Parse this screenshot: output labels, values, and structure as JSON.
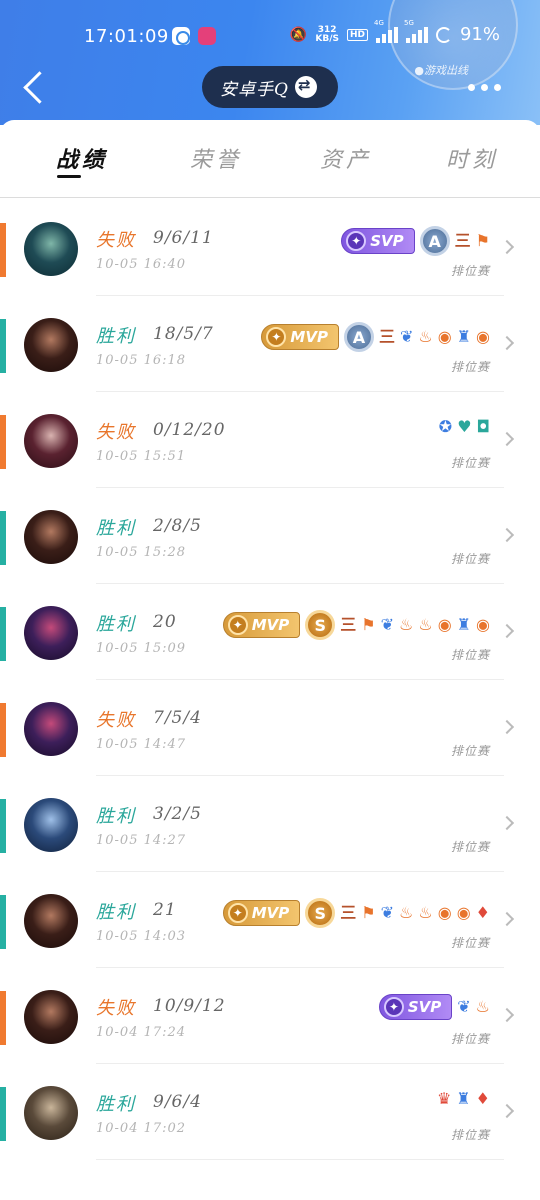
{
  "status_bar": {
    "time": "17:01:09",
    "net_speed_value": "312",
    "net_speed_unit": "KB/S",
    "hd": "HD",
    "sig1": "4G",
    "sig2": "5G",
    "battery": "91%"
  },
  "header": {
    "account_label": "安卓手Q",
    "deco_label": "●游戏出线"
  },
  "tabs": [
    "战绩",
    "荣誉",
    "资产",
    "时刻"
  ],
  "matches": [
    {
      "result": "失败",
      "outcome": "lose",
      "kda": "9/6/11",
      "time": "10-05 16:40",
      "mode": "排位赛",
      "badge": {
        "type": "svp",
        "label": "SVP"
      },
      "grade": "A",
      "icons": [
        "三",
        "⚑"
      ],
      "avatar_colors": [
        "#1f4b55",
        "#7fb6a8",
        "#0c2b33"
      ]
    },
    {
      "result": "胜利",
      "outcome": "win",
      "kda": "18/5/7",
      "time": "10-05 16:18",
      "mode": "排位赛",
      "badge": {
        "type": "mvp",
        "label": "MVP"
      },
      "grade": "A",
      "icons": [
        "三",
        "❦",
        "♨",
        "◉",
        "♜",
        "◉"
      ],
      "avatar_colors": [
        "#3a1e18",
        "#b27960",
        "#1a0b09"
      ]
    },
    {
      "result": "失败",
      "outcome": "lose",
      "kda": "0/12/20",
      "time": "10-05 15:51",
      "mode": "排位赛",
      "badge": null,
      "grade": null,
      "icons": [
        "✪",
        "♥",
        "◘"
      ],
      "avatar_colors": [
        "#5a2230",
        "#d9b3b0",
        "#2a0d14"
      ]
    },
    {
      "result": "胜利",
      "outcome": "win",
      "kda": "2/8/5",
      "time": "10-05 15:28",
      "mode": "排位赛",
      "badge": null,
      "grade": null,
      "icons": [],
      "avatar_colors": [
        "#3a1e18",
        "#b27960",
        "#1a0b09"
      ]
    },
    {
      "result": "胜利",
      "outcome": "win",
      "kda": "20",
      "time": "10-05 15:09",
      "mode": "排位赛",
      "badge": {
        "type": "mvp",
        "label": "MVP"
      },
      "grade": "S",
      "icons": [
        "三",
        "⚑",
        "❦",
        "♨",
        "♨",
        "◉",
        "♜",
        "◉"
      ],
      "avatar_colors": [
        "#3d1f5a",
        "#c44a7a",
        "#150a26"
      ]
    },
    {
      "result": "失败",
      "outcome": "lose",
      "kda": "7/5/4",
      "time": "10-05 14:47",
      "mode": "排位赛",
      "badge": null,
      "grade": null,
      "icons": [],
      "avatar_colors": [
        "#3d1f5a",
        "#c44a7a",
        "#150a26"
      ]
    },
    {
      "result": "胜利",
      "outcome": "win",
      "kda": "3/2/5",
      "time": "10-05 14:27",
      "mode": "排位赛",
      "badge": null,
      "grade": null,
      "icons": [],
      "avatar_colors": [
        "#2b4a7a",
        "#9fc0e8",
        "#0f1f3a"
      ]
    },
    {
      "result": "胜利",
      "outcome": "win",
      "kda": "21",
      "time": "10-05 14:03",
      "mode": "排位赛",
      "badge": {
        "type": "mvp",
        "label": "MVP"
      },
      "grade": "S",
      "icons": [
        "三",
        "⚑",
        "❦",
        "♨",
        "♨",
        "◉",
        "◉",
        "♦"
      ],
      "avatar_colors": [
        "#3a1e18",
        "#b27960",
        "#1a0b09"
      ]
    },
    {
      "result": "失败",
      "outcome": "lose",
      "kda": "10/9/12",
      "time": "10-04 17:24",
      "mode": "排位赛",
      "badge": {
        "type": "svp",
        "label": "SVP"
      },
      "grade": null,
      "icons": [
        "❦",
        "♨"
      ],
      "avatar_colors": [
        "#3a1e18",
        "#b27960",
        "#1a0b09"
      ]
    },
    {
      "result": "胜利",
      "outcome": "win",
      "kda": "9/6/4",
      "time": "10-04 17:02",
      "mode": "排位赛",
      "badge": null,
      "grade": null,
      "icons": [
        "♛",
        "♜",
        "♦"
      ],
      "avatar_colors": [
        "#5a4a3a",
        "#c9b59a",
        "#2a2016"
      ]
    }
  ]
}
